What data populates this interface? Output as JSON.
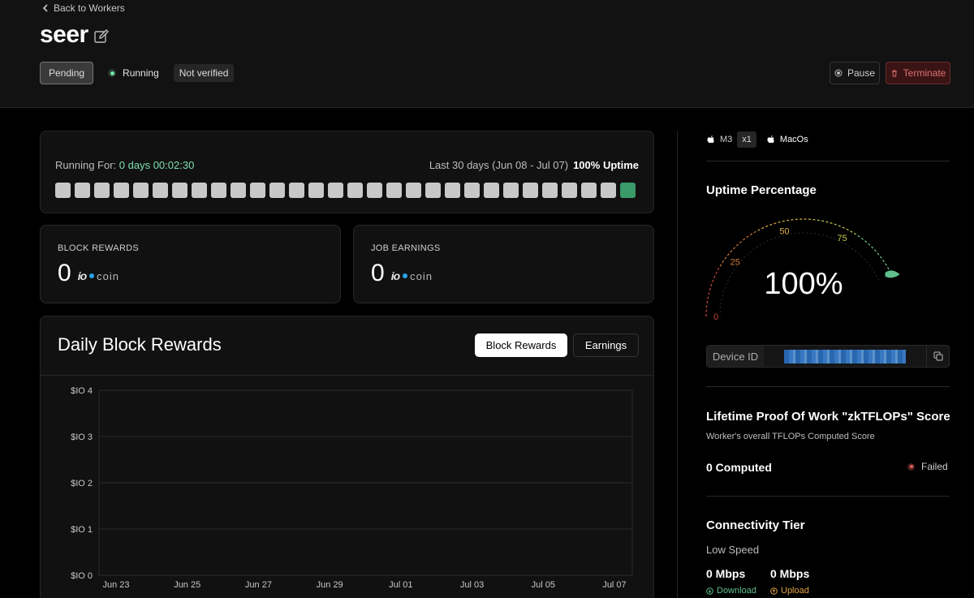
{
  "header": {
    "back_label": "Back to Workers",
    "title": "seer",
    "status": {
      "pending": "Pending",
      "running": "Running",
      "verification": "Not verified"
    },
    "pause_label": "Pause",
    "terminate_label": "Terminate"
  },
  "uptime_card": {
    "running_for_label": "Running For:",
    "running_for_value": "0 days 00:02:30",
    "range_label": "Last 30 days (Jun 08 - Jul 07)",
    "uptime_label": "100% Uptime",
    "days_total": 30,
    "days_active": 1
  },
  "block_rewards": {
    "label": "BLOCK REWARDS",
    "value": "0",
    "logo_io": "io",
    "logo_coin": "coin"
  },
  "job_earnings": {
    "label": "JOB EARNINGS",
    "value": "0",
    "logo_io": "io",
    "logo_coin": "coin"
  },
  "daily_chart": {
    "title": "Daily Block Rewards",
    "tab_block_rewards": "Block Rewards",
    "tab_earnings": "Earnings"
  },
  "chart_data": {
    "type": "bar",
    "title": "Daily Block Rewards",
    "xlabel": "",
    "ylabel": "",
    "ylim": [
      0,
      4
    ],
    "y_ticks": [
      "$IO 0",
      "$IO 1",
      "$IO 2",
      "$IO 3",
      "$IO 4"
    ],
    "categories": [
      "Jun 23",
      "Jun 25",
      "Jun 27",
      "Jun 29",
      "Jul 01",
      "Jul 03",
      "Jul 05",
      "Jul 07"
    ],
    "values": [
      0,
      0,
      0,
      0,
      0,
      0,
      0,
      0
    ],
    "grid": true
  },
  "sidebar": {
    "chip": "M3",
    "chip_count": "x1",
    "os": "MacOs",
    "uptime_title": "Uptime Percentage",
    "gauge": {
      "value": 100,
      "value_label": "100%",
      "ticks": [
        "0",
        "25",
        "50",
        "75"
      ]
    },
    "device_id_label": "Device ID",
    "pow_title": "Lifetime Proof Of Work \"zkTFLOPs\" Score",
    "pow_sub": "Worker's overall TFLOPs Computed Score",
    "computed": "0 Computed",
    "pow_status": "Failed",
    "conn_title": "Connectivity Tier",
    "conn_speed": "Low Speed",
    "download_value": "0 Mbps",
    "upload_value": "0 Mbps",
    "download_label": "Download",
    "upload_label": "Upload"
  },
  "colors": {
    "accent_green": "#7ee0b0",
    "active_day": "#3a9a6a",
    "danger": "#e07070",
    "coin_blue": "#2aa3e8"
  }
}
